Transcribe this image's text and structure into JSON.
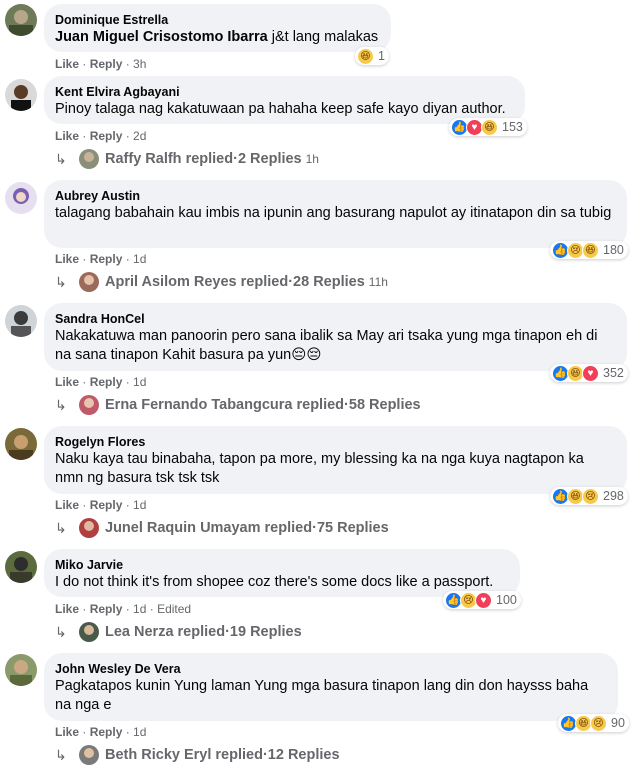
{
  "comments": [
    {
      "author": "Dominique Estrella",
      "tag": "Juan Miguel Crisostomo Ibarra",
      "text": " j&t lang malakas",
      "reaction_count": "1",
      "reactions": [
        "haha"
      ],
      "like_label": "Like",
      "reply_label": "Reply",
      "time": "3h",
      "edited": ""
    },
    {
      "author": "Kent Elvira Agbayani",
      "text": "Pinoy talaga nag kakatuwaan pa hahaha keep safe kayo diyan author.",
      "reaction_count": "153",
      "reactions": [
        "like",
        "heart",
        "haha"
      ],
      "like_label": "Like",
      "reply_label": "Reply",
      "time": "2d",
      "replies": {
        "name": "Raffy Ralfh replied",
        "count": "2 Replies",
        "time": "1h"
      }
    },
    {
      "author": "Aubrey Austin",
      "text": "talagang babahain kau imbis na ipunin ang basurang napulot ay itinatapon din sa tubig",
      "reaction_count": "180",
      "reactions": [
        "like",
        "sad",
        "haha"
      ],
      "like_label": "Like",
      "reply_label": "Reply",
      "time": "1d",
      "replies": {
        "name": "April Asilom Reyes replied",
        "count": "28 Replies",
        "time": "11h"
      }
    },
    {
      "author": "Sandra HonCel",
      "text": "Nakakatuwa man panoorin pero sana ibalik sa May ari tsaka yung mga tinapon eh di na sana tinapon Kahit basura pa yun😔😔",
      "reaction_count": "352",
      "reactions": [
        "like",
        "haha",
        "heart"
      ],
      "like_label": "Like",
      "reply_label": "Reply",
      "time": "1d",
      "replies": {
        "name": "Erna Fernando Tabangcura replied",
        "count": "58 Replies",
        "time": ""
      }
    },
    {
      "author": "Rogelyn Flores",
      "text": "Naku kaya tau binabaha, tapon pa more, my blessing ka na nga kuya nagtapon ka nmn ng basura tsk tsk tsk",
      "reaction_count": "298",
      "reactions": [
        "like",
        "haha",
        "sad"
      ],
      "like_label": "Like",
      "reply_label": "Reply",
      "time": "1d",
      "replies": {
        "name": "Junel Raquin Umayam replied",
        "count": "75 Replies",
        "time": ""
      }
    },
    {
      "author": "Miko Jarvie",
      "text": "I do not think it's from shopee coz there's some docs like a passport.",
      "reaction_count": "100",
      "reactions": [
        "like",
        "sad",
        "heart"
      ],
      "like_label": "Like",
      "reply_label": "Reply",
      "time": "1d",
      "edited": "Edited",
      "replies": {
        "name": "Lea Nerza replied",
        "count": "19 Replies",
        "time": ""
      }
    },
    {
      "author": "John Wesley De Vera",
      "text": "Pagkatapos kunin Yung laman Yung mga basura tinapon lang din don haysss baha na nga e",
      "reaction_count": "90",
      "reactions": [
        "like",
        "haha",
        "sad"
      ],
      "like_label": "Like",
      "reply_label": "Reply",
      "time": "1d",
      "replies": {
        "name": "Beth Ricky Eryl replied",
        "count": "12 Replies",
        "time": ""
      }
    }
  ],
  "separator": " · ",
  "reply_arrow_icon": "reply-arrow-icon",
  "colors": {
    "bubble": "#f0f2f5",
    "meta": "#65676b",
    "like": "#1877f2",
    "heart": "#f33e58",
    "emoji": "#f7c94b"
  }
}
